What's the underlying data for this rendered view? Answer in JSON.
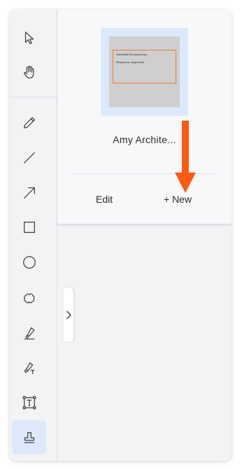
{
  "toolbar": {
    "tools": [
      {
        "name": "select",
        "icon": "cursor-arrow-icon"
      },
      {
        "name": "pan",
        "icon": "hand-icon"
      },
      {
        "name": "pen",
        "icon": "pencil-icon"
      },
      {
        "name": "line",
        "icon": "line-icon"
      },
      {
        "name": "arrow",
        "icon": "arrow-icon"
      },
      {
        "name": "rectangle",
        "icon": "rectangle-icon"
      },
      {
        "name": "ellipse",
        "icon": "circle-icon"
      },
      {
        "name": "cloud",
        "icon": "cloud-icon"
      },
      {
        "name": "highlighter",
        "icon": "highlighter-icon"
      },
      {
        "name": "text-highlight",
        "icon": "text-highlighter-icon"
      },
      {
        "name": "text-box",
        "icon": "text-box-icon"
      },
      {
        "name": "stamp",
        "icon": "stamp-icon",
        "active": true
      }
    ],
    "collapse_icon": "chevron-right-icon"
  },
  "stamp_panel": {
    "stamp_preview": {
      "line1": "Submittal Reviewed by:",
      "line2": "Response: Approved"
    },
    "stamp_name": "Amy Archite...",
    "edit_label": "Edit",
    "new_label": "+ New"
  },
  "colors": {
    "accent_arrow": "#ff5a14",
    "stamp_border": "#ef7a32",
    "active_tool_bg": "#dde9fb"
  }
}
